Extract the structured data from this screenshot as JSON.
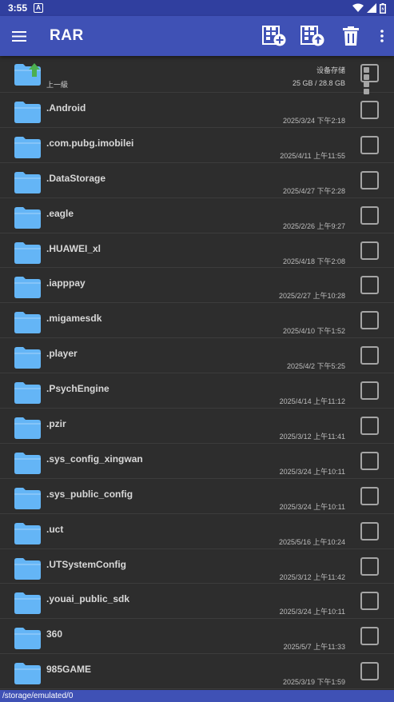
{
  "status": {
    "time": "3:55",
    "badge": "A"
  },
  "app": {
    "title": "RAR"
  },
  "up_row": {
    "label": "上一級",
    "storage_label": "设备存储",
    "storage_size": "25 GB / 28.8 GB"
  },
  "files": [
    {
      "name": ".Android",
      "date": "2025/3/24 下午2:18"
    },
    {
      "name": ".com.pubg.imobilei",
      "date": "2025/4/11 上午11:55"
    },
    {
      "name": ".DataStorage",
      "date": "2025/4/27 下午2:28"
    },
    {
      "name": ".eagle",
      "date": "2025/2/26 上午9:27"
    },
    {
      "name": ".HUAWEI_xl",
      "date": "2025/4/18 下午2:08"
    },
    {
      "name": ".iapppay",
      "date": "2025/2/27 上午10:28"
    },
    {
      "name": ".migamesdk",
      "date": "2025/4/10 下午1:52"
    },
    {
      "name": ".player",
      "date": "2025/4/2 下午5:25"
    },
    {
      "name": ".PsychEngine",
      "date": "2025/4/14 上午11:12"
    },
    {
      "name": ".pzir",
      "date": "2025/3/12 上午11:41"
    },
    {
      "name": ".sys_config_xingwan",
      "date": "2025/3/24 上午10:11"
    },
    {
      "name": ".sys_public_config",
      "date": "2025/3/24 上午10:11"
    },
    {
      "name": ".uct",
      "date": "2025/5/16 上午10:24"
    },
    {
      "name": ".UTSystemConfig",
      "date": "2025/3/12 上午11:42"
    },
    {
      "name": ".youai_public_sdk",
      "date": "2025/3/24 上午10:11"
    },
    {
      "name": "360",
      "date": "2025/5/7 上午11:33"
    },
    {
      "name": "985GAME",
      "date": "2025/3/19 下午1:59"
    }
  ],
  "path_bar": {
    "path": "/storage/emulated/0"
  },
  "colors": {
    "primary": "#3f51b5",
    "primary_dark": "#303f9f",
    "folder": "#64b5f6",
    "up_arrow": "#4caf50",
    "background": "#2d2d2d"
  }
}
